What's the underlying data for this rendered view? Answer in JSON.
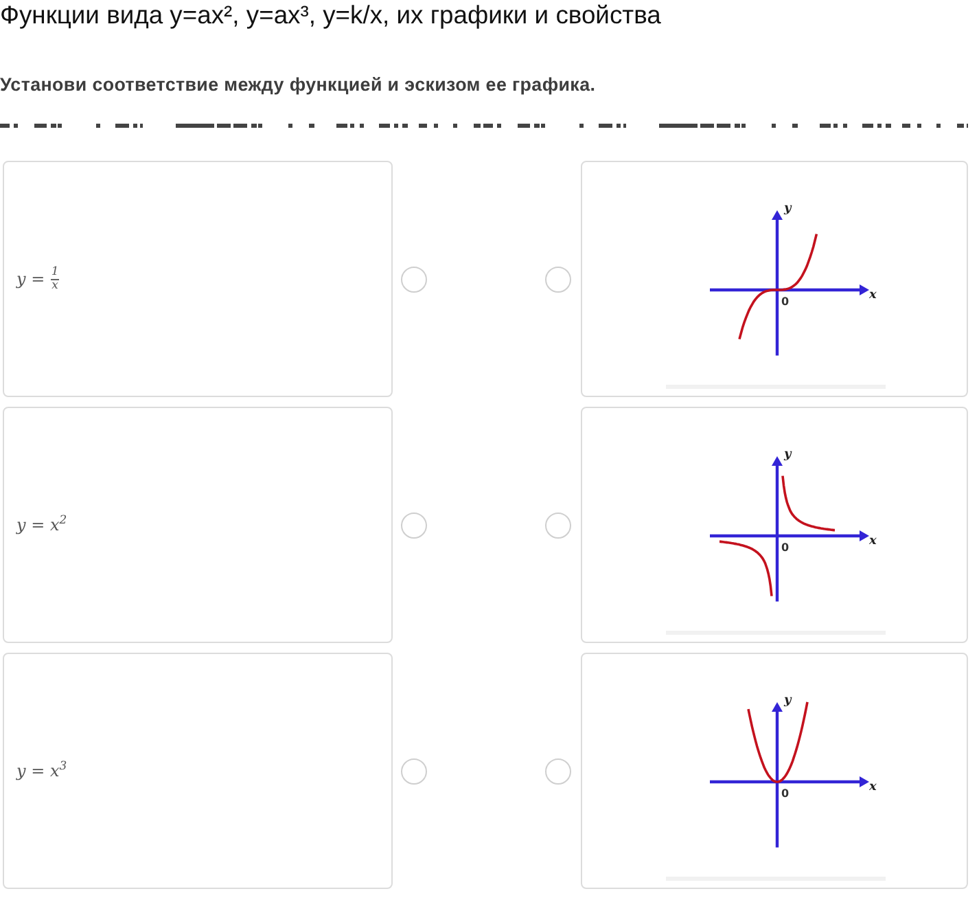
{
  "title": "Функции вида y=ax², y=ax³, y=k/x, их графики и свойства",
  "instruction": "Установи соответствие между функцией и эскизом ее графика.",
  "rows": [
    {
      "formula": {
        "kind": "fraction",
        "lhs": "y =",
        "numerator": "1",
        "denominator": "x"
      },
      "radios": [
        {
          "selected": false
        },
        {
          "selected": false
        }
      ],
      "graph": {
        "kind": "cubic",
        "y_label": "y",
        "x_label": "x",
        "origin_label": "0"
      }
    },
    {
      "formula": {
        "kind": "inline",
        "text": "y = x$^{2}$"
      },
      "radios": [
        {
          "selected": false
        },
        {
          "selected": false
        }
      ],
      "graph": {
        "kind": "hyperbola",
        "y_label": "y",
        "x_label": "x",
        "origin_label": "0"
      }
    },
    {
      "formula": {
        "kind": "inline",
        "text": "y = x$^{3}$"
      },
      "radios": [
        {
          "selected": false
        },
        {
          "selected": false
        }
      ],
      "graph": {
        "kind": "parabola",
        "y_label": "y",
        "x_label": "x",
        "origin_label": "0"
      }
    }
  ]
}
